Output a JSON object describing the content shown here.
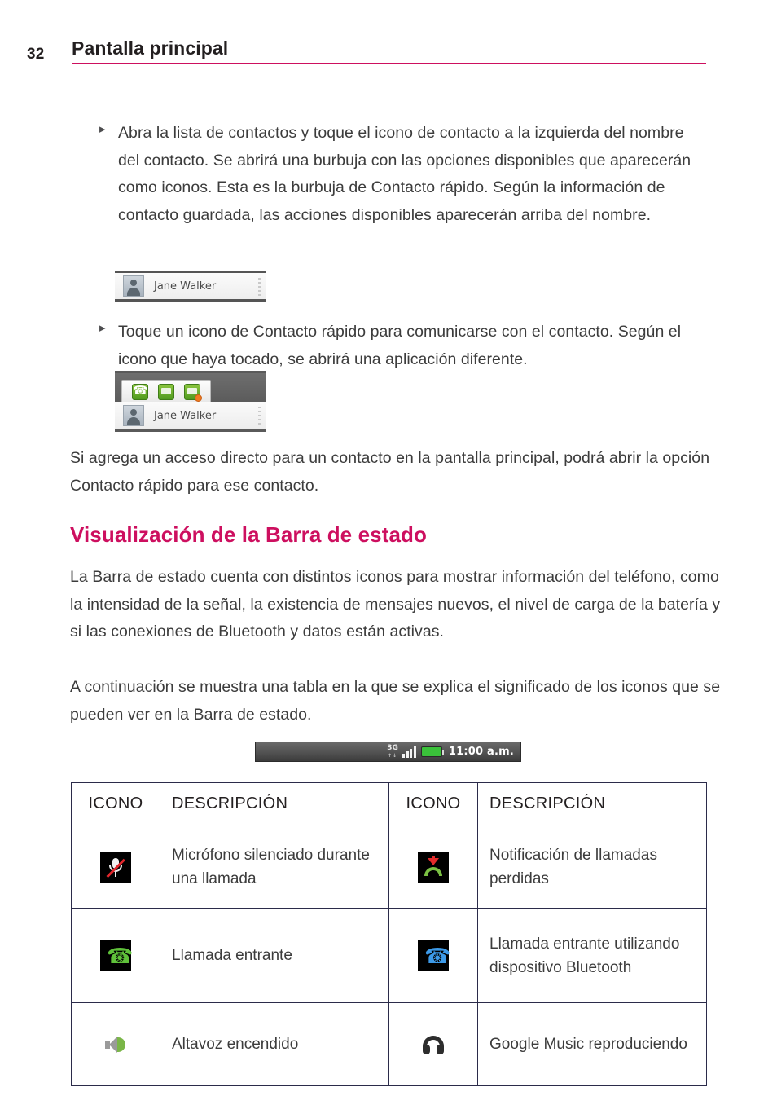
{
  "header": {
    "page_number": "32",
    "title": "Pantalla principal",
    "rule_color": "#cd0f5f"
  },
  "bullets": [
    {
      "marker": "▸",
      "text": "Abra la lista de contactos y toque el icono de contacto a la izquierda del nombre del contacto. Se abrirá una burbuja con las opciones disponibles que aparecerán como iconos. Esta es la burbuja de Contacto rápido. Según la información de contacto guardada, las acciones disponibles aparecerán arriba del nombre."
    },
    {
      "marker": "▸",
      "text": "Toque un icono de Contacto rápido para comunicarse con el contacto. Según el icono que haya tocado, se abrirá una aplicación diferente."
    }
  ],
  "figures": {
    "contact_row": {
      "contact_name": "Jane Walker",
      "avatar_icon": "contact-avatar-icon"
    },
    "quick_contact_bubble": {
      "contact_name": "Jane Walker",
      "icons": [
        "phone-icon",
        "message-icon",
        "message-unread-icon"
      ]
    },
    "status_bar": {
      "network_label": "3G",
      "network_sub": "↑↓",
      "signal_icon": "signal-bars-icon",
      "battery_icon": "battery-icon",
      "time": "11:00 a.m."
    }
  },
  "paragraphs": {
    "shortcut": "Si agrega un acceso directo para un contacto en la pantalla principal, podrá abrir la opción Contacto rápido para ese contacto.",
    "statusbar_intro": "La Barra de estado cuenta con distintos iconos para mostrar información del teléfono, como la intensidad de la señal, la existencia de mensajes nuevos, el nivel de carga de la batería y si las conexiones de Bluetooth y datos están activas.",
    "table_intro": "A continuación se muestra una tabla en la que se explica el significado de los iconos que se pueden ver en la Barra de estado."
  },
  "section_heading": "Visualización de la Barra de estado",
  "icon_table": {
    "headers": [
      "ICONO",
      "DESCRIPCIÓN",
      "ICONO",
      "DESCRIPCIÓN"
    ],
    "rows": [
      {
        "left_icon": "microphone-muted-icon",
        "left_desc": "Micrófono silenciado durante una llamada",
        "right_icon": "missed-call-icon",
        "right_desc": "Notificación de llamadas perdidas"
      },
      {
        "left_icon": "incoming-call-icon",
        "left_desc": "Llamada entrante",
        "right_icon": "bluetooth-call-icon",
        "right_desc": "Llamada entrante utilizando dispositivo Bluetooth"
      },
      {
        "left_icon": "speaker-on-icon",
        "left_desc": "Altavoz encendido",
        "right_icon": "headphones-icon",
        "right_desc": "Google Music reproduciendo"
      }
    ]
  }
}
